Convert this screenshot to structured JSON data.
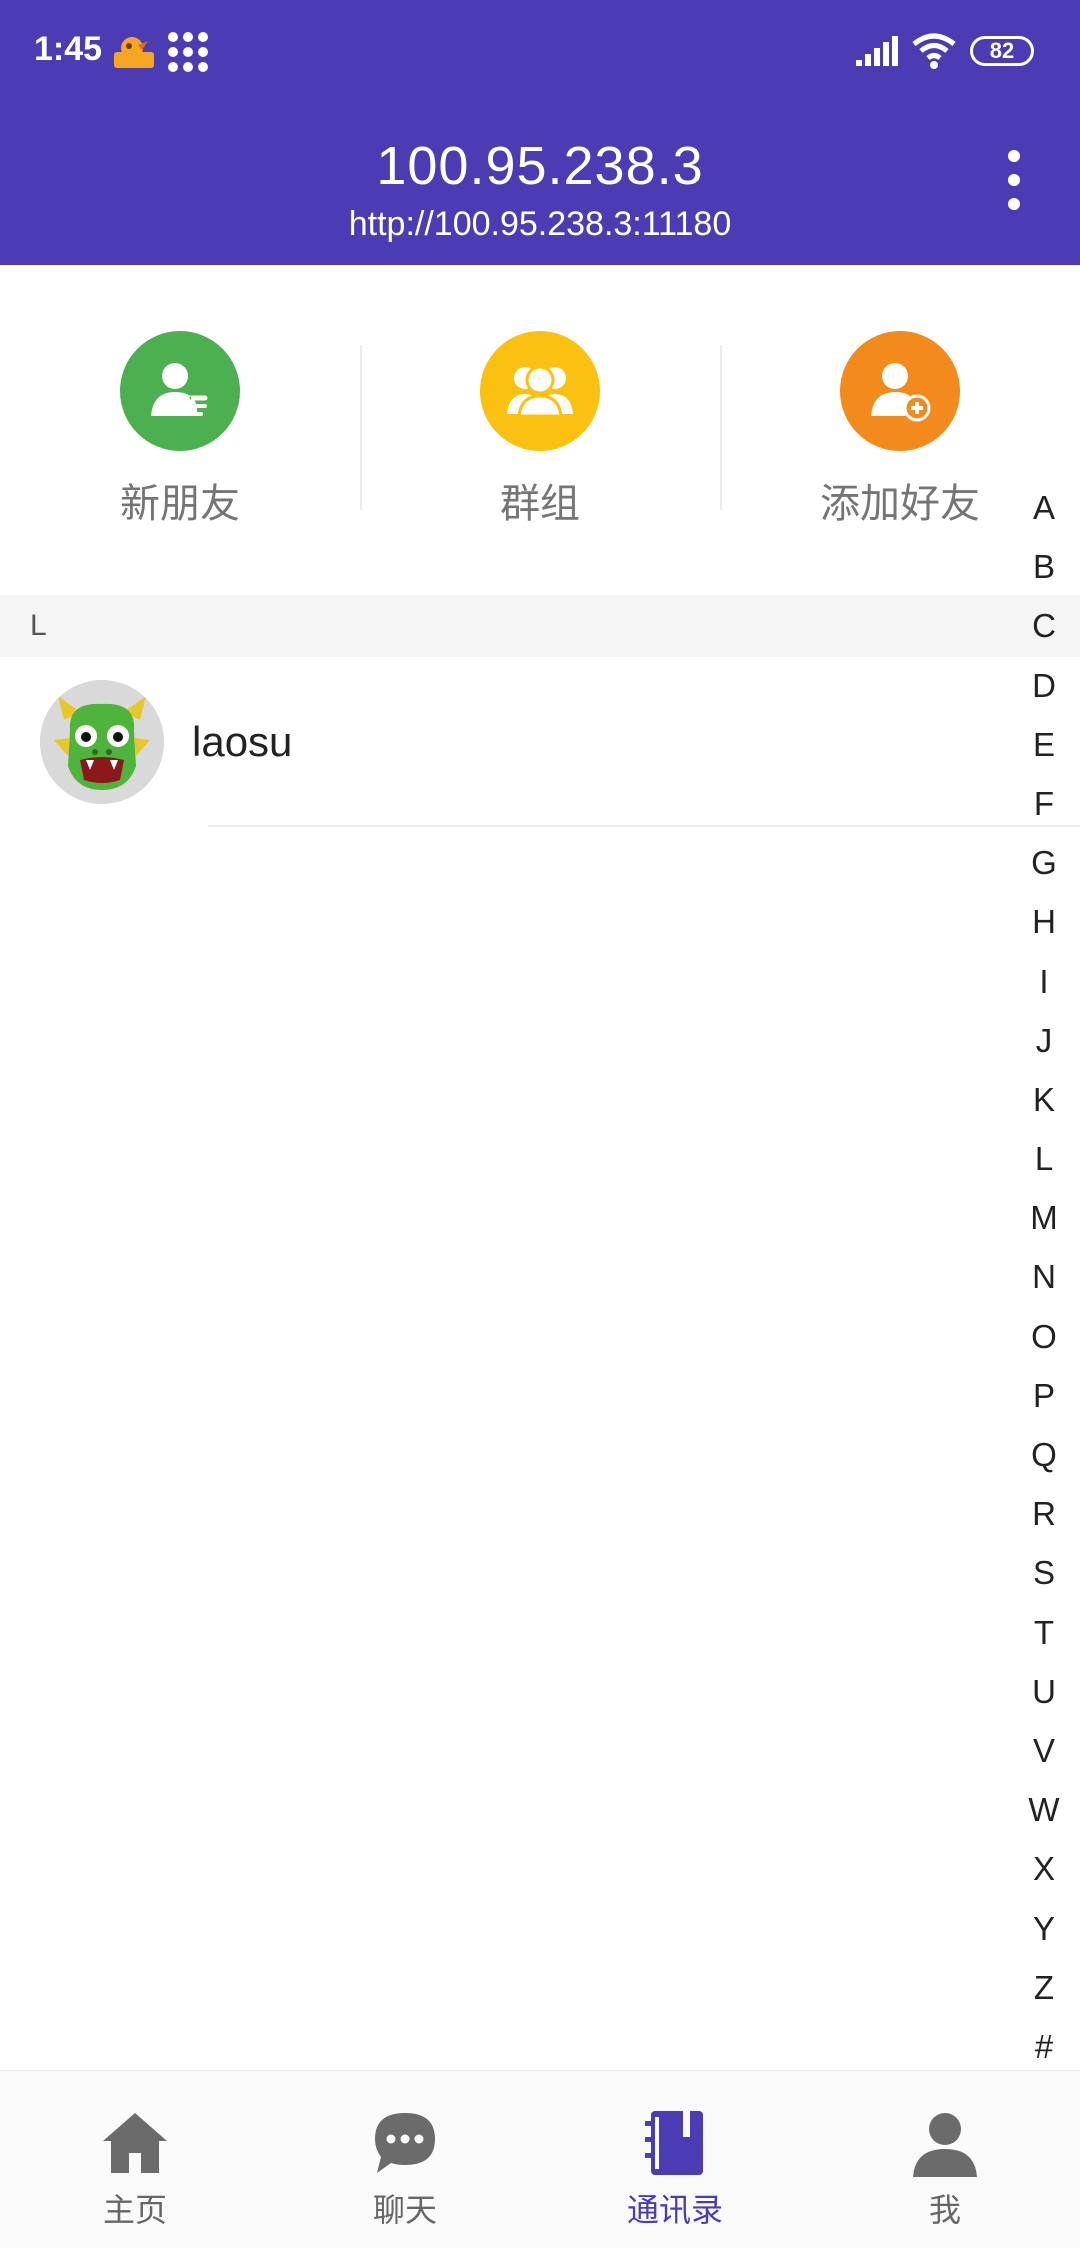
{
  "status": {
    "time": "1:45",
    "battery": "82"
  },
  "header": {
    "title": "100.95.238.3",
    "subtitle": "http://100.95.238.3:11180"
  },
  "quick_actions": [
    {
      "label": "新朋友",
      "icon": "new-friends-icon",
      "color": "#4caf50"
    },
    {
      "label": "群组",
      "icon": "group-icon",
      "color": "#fbc111"
    },
    {
      "label": "添加好友",
      "icon": "add-friend-icon",
      "color": "#f28a1c"
    }
  ],
  "section": {
    "letter": "L"
  },
  "contacts": [
    {
      "name": "laosu",
      "avatar": "dragon-avatar"
    }
  ],
  "index_letters": [
    "A",
    "B",
    "C",
    "D",
    "E",
    "F",
    "G",
    "H",
    "I",
    "J",
    "K",
    "L",
    "M",
    "N",
    "O",
    "P",
    "Q",
    "R",
    "S",
    "T",
    "U",
    "V",
    "W",
    "X",
    "Y",
    "Z",
    "#"
  ],
  "nav": [
    {
      "label": "主页",
      "icon": "home-icon",
      "active": false
    },
    {
      "label": "聊天",
      "icon": "chat-icon",
      "active": false
    },
    {
      "label": "通讯录",
      "icon": "contacts-icon",
      "active": true
    },
    {
      "label": "我",
      "icon": "profile-icon",
      "active": false
    }
  ],
  "colors": {
    "primary": "#4c3cb3",
    "active_nav": "#4c3cb3"
  }
}
